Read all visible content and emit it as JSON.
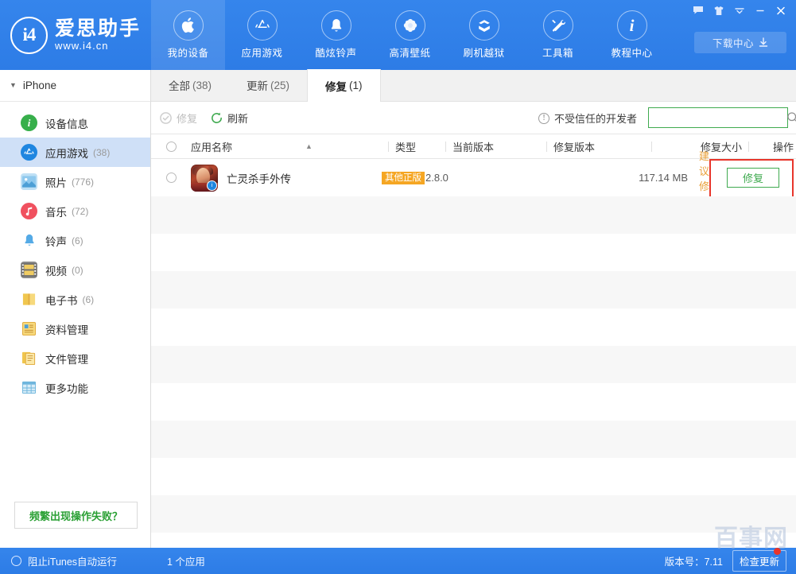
{
  "brand": {
    "logo_mark": "i4",
    "name": "爱思助手",
    "url": "www.i4.cn",
    "accent_blue": "#2f7fe8",
    "accent_green": "#3faa4f",
    "accent_orange": "#f5a623",
    "highlight_red": "#e8352b"
  },
  "header": {
    "nav": [
      {
        "label": "我的设备",
        "icon": "apple-icon",
        "active": true
      },
      {
        "label": "应用游戏",
        "icon": "appstore-icon",
        "active": false
      },
      {
        "label": "酷炫铃声",
        "icon": "bell-icon",
        "active": false
      },
      {
        "label": "高清壁纸",
        "icon": "flower-icon",
        "active": false
      },
      {
        "label": "刷机越狱",
        "icon": "box-icon",
        "active": false
      },
      {
        "label": "工具箱",
        "icon": "tools-icon",
        "active": false
      },
      {
        "label": "教程中心",
        "icon": "info-icon",
        "active": false
      }
    ],
    "download_center": "下载中心",
    "window_buttons": [
      "message-icon",
      "skin-icon",
      "chevron-down-icon",
      "minimize-icon",
      "close-icon"
    ]
  },
  "sidebar": {
    "device": "iPhone",
    "items": [
      {
        "label": "设备信息",
        "count": "",
        "icon": "info-circle-icon",
        "color": "#37af4b",
        "active": false
      },
      {
        "label": "应用游戏",
        "count": "(38)",
        "icon": "appstore-icon",
        "color": "#1f86e0",
        "active": true
      },
      {
        "label": "照片",
        "count": "(776)",
        "icon": "photo-icon",
        "color": "#5ab0e8",
        "active": false
      },
      {
        "label": "音乐",
        "count": "(72)",
        "icon": "music-icon",
        "color": "#f0515f",
        "active": false
      },
      {
        "label": "铃声",
        "count": "(6)",
        "icon": "bell-icon",
        "color": "#4aa8e8",
        "active": false
      },
      {
        "label": "视频",
        "count": "(0)",
        "icon": "video-icon",
        "color": "#e8c24a",
        "active": false
      },
      {
        "label": "电子书",
        "count": "(6)",
        "icon": "book-icon",
        "color": "#f2c84b",
        "active": false
      },
      {
        "label": "资料管理",
        "count": "",
        "icon": "data-icon",
        "color": "#f2c84b",
        "active": false
      },
      {
        "label": "文件管理",
        "count": "",
        "icon": "file-icon",
        "color": "#f2c84b",
        "active": false
      },
      {
        "label": "更多功能",
        "count": "",
        "icon": "grid-icon",
        "color": "#7fc4e8",
        "active": false
      }
    ],
    "help_button": "频繁出现操作失败？"
  },
  "main": {
    "tabs": [
      {
        "label": "全部",
        "count": "(38)",
        "active": false
      },
      {
        "label": "更新",
        "count": "(25)",
        "active": false
      },
      {
        "label": "修复",
        "count": "(1)",
        "active": true
      }
    ],
    "actions": {
      "repair": "修复",
      "repair_disabled": true,
      "refresh": "刷新"
    },
    "untrusted_developer": "不受信任的开发者",
    "search": {
      "value": "",
      "placeholder": ""
    },
    "table": {
      "headers": [
        "应用名称",
        "类型",
        "当前版本",
        "修复版本",
        "修复大小",
        "操作"
      ],
      "sort_column": "应用名称",
      "sort_direction": "asc",
      "rows": [
        {
          "name": "亡灵杀手外传",
          "type": "其他正版",
          "current_version": "2.8.0",
          "fix_version": "",
          "fix_size": "117.14 MB",
          "recommend": "建议修复",
          "action": "修复",
          "highlighted": true
        }
      ],
      "empty_rows": 9
    }
  },
  "statusbar": {
    "block_itunes": "阻止iTunes自动运行",
    "app_count": "1 个应用",
    "version": "版本号：7.11",
    "check_update": "检查更新"
  },
  "watermark": "百事网"
}
